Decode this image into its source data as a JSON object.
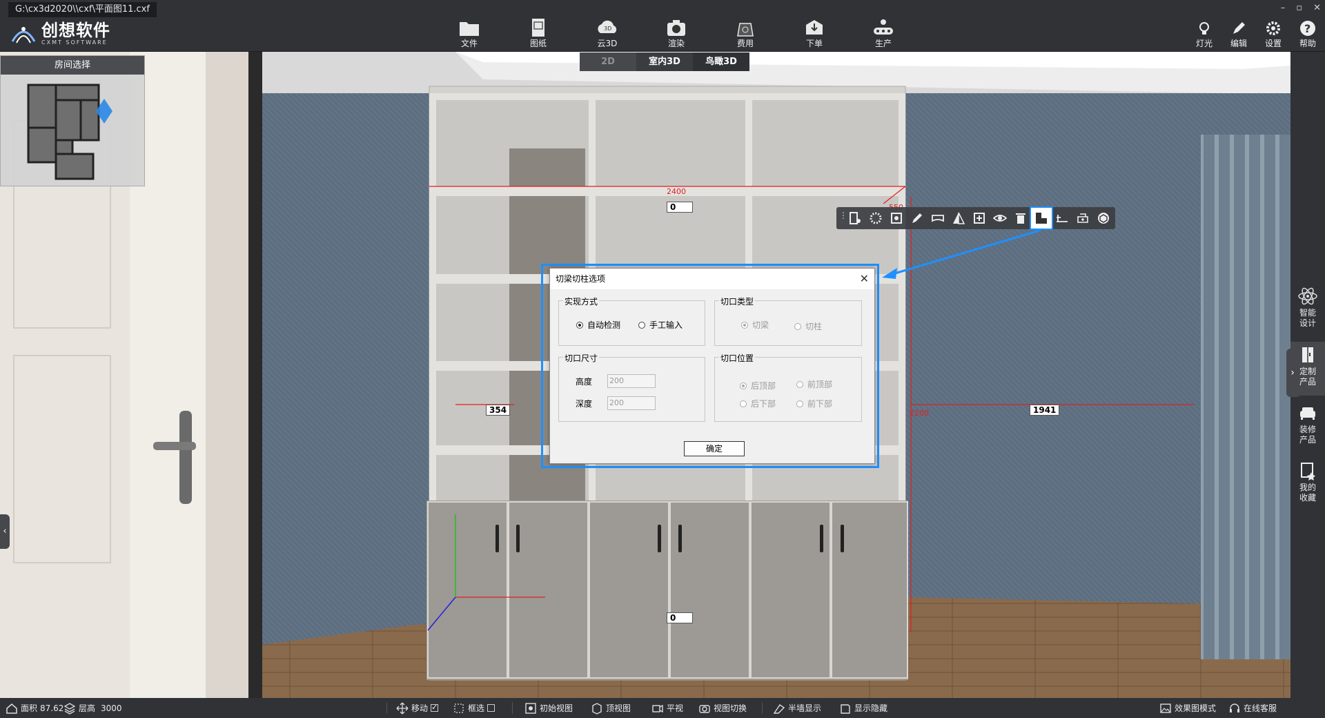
{
  "window": {
    "path": "G:\\cx3d2020\\\\cxf\\平面图11.cxf",
    "controls": [
      "–",
      "▫",
      "✕"
    ]
  },
  "logo": {
    "cn": "创想软件",
    "en": "CXMT SOFTWARE"
  },
  "toolbar": {
    "items": [
      {
        "label": "文件",
        "icon": "folder-icon"
      },
      {
        "label": "图纸",
        "icon": "drawing-icon"
      },
      {
        "label": "云3D",
        "icon": "cloud-3d-icon"
      },
      {
        "label": "渲染",
        "icon": "camera-icon"
      },
      {
        "label": "费用",
        "icon": "money-icon"
      },
      {
        "label": "下单",
        "icon": "order-icon"
      },
      {
        "label": "生产",
        "icon": "production-icon"
      }
    ],
    "right_items": [
      {
        "label": "灯光",
        "icon": "light-icon"
      },
      {
        "label": "编辑",
        "icon": "edit-icon"
      },
      {
        "label": "设置",
        "icon": "gear-icon"
      },
      {
        "label": "帮助",
        "icon": "help-icon"
      }
    ]
  },
  "view_tabs": [
    {
      "label": "2D",
      "state": "dim"
    },
    {
      "label": "室内3D",
      "state": "normal"
    },
    {
      "label": "鸟瞰3D",
      "state": "active"
    }
  ],
  "room_panel": {
    "title": "房间选择"
  },
  "dimensions": {
    "top_width": "2400",
    "top_offset": "0",
    "depth": "550",
    "left_gap": "354",
    "right_gap": "1941",
    "height": "2200",
    "bottom_offset": "0"
  },
  "dialog": {
    "title": "切梁切柱选项",
    "close": "✕",
    "method_group": "实现方式",
    "method_auto": "自动检测",
    "method_manual": "手工输入",
    "type_group": "切口类型",
    "type_beam": "切梁",
    "type_column": "切柱",
    "size_group": "切口尺寸",
    "height_label": "高度",
    "height_value": "200",
    "depth_label": "深度",
    "depth_value": "200",
    "position_group": "切口位置",
    "pos_back_top": "后顶部",
    "pos_front_top": "前顶部",
    "pos_back_bottom": "后下部",
    "pos_front_bottom": "前下部",
    "ok": "确定"
  },
  "right_bar": [
    {
      "label1": "智能",
      "label2": "设计",
      "icon": "atom-icon"
    },
    {
      "label1": "定制",
      "label2": "产品",
      "icon": "cabinet-icon"
    },
    {
      "label1": "装修",
      "label2": "产品",
      "icon": "sofa-icon"
    },
    {
      "label1": "我的",
      "label2": "收藏",
      "icon": "favorite-icon"
    }
  ],
  "status": {
    "area_label": "面积",
    "area_value": "87.62",
    "floor_label": "层高",
    "floor_value": "3000",
    "move": "移动",
    "box_select": "框选",
    "initial_view": "初始视图",
    "top_view": "顶视图",
    "flat_view": "平视",
    "view_switch": "视图切换",
    "half_wall": "半墙显示",
    "show_hide": "显示隐藏",
    "render_mode": "效果图模式",
    "online_service": "在线客服"
  },
  "colors": {
    "accent": "#1e90ff",
    "dim_red": "#e02020",
    "chrome": "#303236"
  }
}
